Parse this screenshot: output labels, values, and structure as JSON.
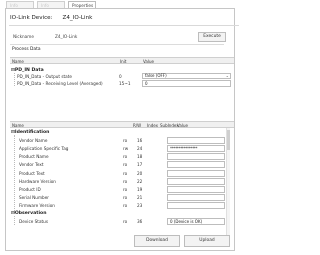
{
  "tabs": [
    "Info",
    "Info",
    "Properties"
  ],
  "header": {
    "title": "IO-Link Device:",
    "device": "Z4_IO-Link"
  },
  "nickname": {
    "label": "Nickname",
    "value": "Z4_IO-Link"
  },
  "execute_label": "Execute",
  "process_data": {
    "title": "Process Data",
    "columns": [
      "Name",
      "Init",
      "Value"
    ],
    "group": "PD_IN Data",
    "rows": [
      {
        "name": "PD_IN_Data - Output state",
        "init": "0",
        "value": "false (OFF)"
      },
      {
        "name": "PD_IN_Data - Receiving Level (Averaged)",
        "init": "15~1",
        "value": "0"
      }
    ]
  },
  "identification": {
    "columns": [
      "Name",
      "R/W",
      "Index",
      "SubIndex",
      "Value"
    ],
    "group": "Identification",
    "rows": [
      {
        "name": "Vendor Name",
        "rw": "ro",
        "index": "16",
        "value": ""
      },
      {
        "name": "Application Specific Tag",
        "rw": "rw",
        "index": "24",
        "value": "****************"
      },
      {
        "name": "Product Name",
        "rw": "ro",
        "index": "18",
        "value": ""
      },
      {
        "name": "Vendor Text",
        "rw": "ro",
        "index": "17",
        "value": ""
      },
      {
        "name": "Product Text",
        "rw": "ro",
        "index": "20",
        "value": ""
      },
      {
        "name": "Hardware Version",
        "rw": "ro",
        "index": "22",
        "value": ""
      },
      {
        "name": "Product ID",
        "rw": "ro",
        "index": "19",
        "value": ""
      },
      {
        "name": "Serial Number",
        "rw": "ro",
        "index": "21",
        "value": ""
      },
      {
        "name": "Firmware Version",
        "rw": "ro",
        "index": "23",
        "value": ""
      }
    ],
    "observation_group": "Observation",
    "observation_rows": [
      {
        "name": "Device Status",
        "rw": "ro",
        "index": "36",
        "value": "0 (Device is OK)"
      }
    ]
  },
  "buttons": {
    "download": "Download",
    "upload": "Upload"
  }
}
